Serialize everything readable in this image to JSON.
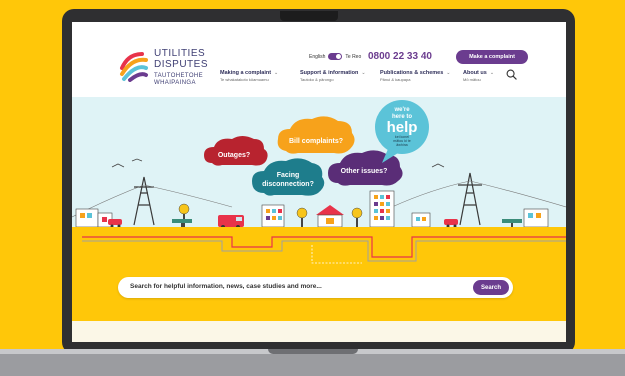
{
  "logo": {
    "line1": "UTILITIES",
    "line2": "DISPUTES",
    "line3": "TAUTOHETOHE",
    "line4": "WHAIPAINGA"
  },
  "lang": {
    "left": "English",
    "right": "Te Reo"
  },
  "phone": "0800 22 33 40",
  "complaint_button": "Make a complaint",
  "nav": [
    {
      "title": "Making a complaint",
      "sub": "Te whakatakoto kōamuamu"
    },
    {
      "title": "Support & information",
      "sub": "Tautoko & pārongo"
    },
    {
      "title": "Publications & schemes",
      "sub": "Pānui & kaupapa"
    },
    {
      "title": "About us",
      "sub": "Mō mātou"
    }
  ],
  "clouds": {
    "outages": "Outages?",
    "bill": "Bill complaints?",
    "facing1": "Facing",
    "facing2": "disconnection?",
    "other": "Other issues?"
  },
  "bubble": {
    "we": "we're",
    "here": "here to",
    "help": "help",
    "sub1": "kei konei",
    "sub2": "mātou ki te",
    "sub3": "āwhina"
  },
  "search": {
    "placeholder": "Search for helpful information, news, case studies and more...",
    "button": "Search"
  },
  "colors": {
    "brand_purple": "#6b3c8f",
    "background_yellow": "#FFC709",
    "hero_sky": "#dff3f6"
  }
}
